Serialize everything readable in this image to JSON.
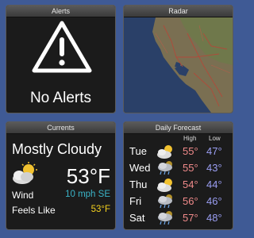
{
  "colors": {
    "background": "#3f5a95",
    "wind": "#3ab4c8",
    "feels_like": "#f5d21e",
    "high": "#f08a8a",
    "low": "#9a9ef2"
  },
  "alerts": {
    "title": "Alerts",
    "status": "No Alerts",
    "icon": "warning-icon"
  },
  "radar": {
    "title": "Radar"
  },
  "current": {
    "title": "Currents",
    "condition": "Mostly Cloudy",
    "temperature": "53°F",
    "icon": "partly-cloudy-icon",
    "wind_label": "Wind",
    "wind_value": "10 mph SE",
    "feels_label": "Feels Like",
    "feels_value": "53°F"
  },
  "forecast": {
    "title": "Daily Forecast",
    "high_header": "High",
    "low_header": "Low",
    "days": [
      {
        "day": "Tue",
        "high": "55°",
        "low": "47°",
        "icon": "partly-cloudy-icon"
      },
      {
        "day": "Wed",
        "high": "55°",
        "low": "43°",
        "icon": "rain-icon"
      },
      {
        "day": "Thu",
        "high": "54°",
        "low": "44°",
        "icon": "partly-cloudy-icon"
      },
      {
        "day": "Fri",
        "high": "56°",
        "low": "46°",
        "icon": "rain-icon"
      },
      {
        "day": "Sat",
        "high": "57°",
        "low": "48°",
        "icon": "rain-icon"
      }
    ]
  }
}
